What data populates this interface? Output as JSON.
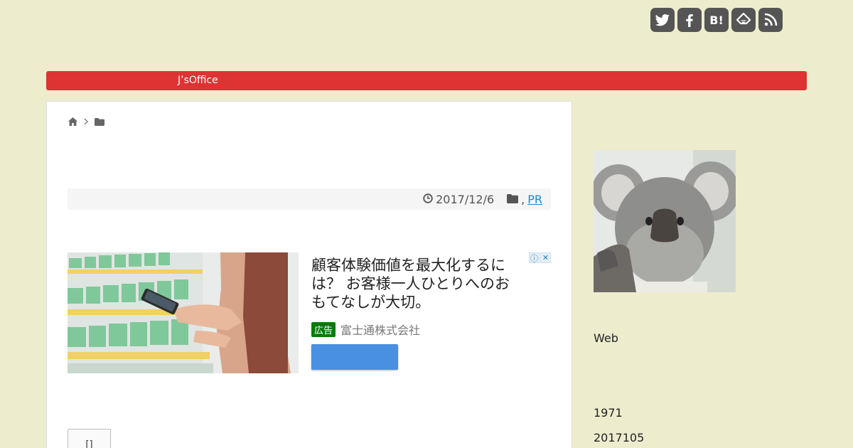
{
  "social": {
    "icons": [
      "twitter-icon",
      "facebook-icon",
      "hatena-bookmark-icon",
      "feedly-icon",
      "rss-icon"
    ],
    "hatena_label": "B!",
    "color": "#555555"
  },
  "nav": {
    "items": [
      "J’sOffice"
    ],
    "color": "#dd3333"
  },
  "breadcrumb": {
    "icons": [
      "home-icon",
      "chevron-right-icon",
      "folder-icon"
    ]
  },
  "meta": {
    "date": "2017/12/6",
    "category_sep": ",",
    "category": "PR"
  },
  "ad": {
    "headline": "顧客体験価値を最大化するには？ お客様一人ひとりへのおもてなしが大切。",
    "badge": "広告",
    "advertiser": "富士通株式会社",
    "adchoices_info": "ⓘ",
    "adchoices_close": "✕",
    "cta_color": "#4a90e2"
  },
  "pager": {
    "label": "[]"
  },
  "sidebar": {
    "text1": "Web",
    "text2": "1971",
    "text3": "2017105"
  },
  "colors": {
    "background": "#ededce",
    "accent": "#dd3333",
    "link": "#1a8ad0"
  }
}
